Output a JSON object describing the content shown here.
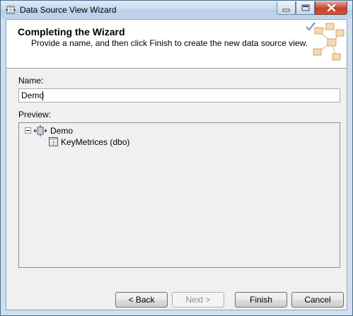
{
  "window": {
    "title": "Data Source View Wizard"
  },
  "header": {
    "title": "Completing the Wizard",
    "subtitle": "Provide a name, and then click Finish to create the new data source view."
  },
  "form": {
    "name_label": "Name:",
    "name_value": "Demo",
    "preview_label": "Preview:"
  },
  "preview_tree": {
    "root": {
      "label": "Demo",
      "expanded": true,
      "icon": "data-source-view-icon"
    },
    "children": [
      {
        "label": "KeyMetrices (dbo)",
        "icon": "table-icon"
      }
    ]
  },
  "buttons": {
    "back": "< Back",
    "next": "Next >",
    "finish": "Finish",
    "cancel": "Cancel"
  },
  "colors": {
    "titlebar": "#c6d9ee",
    "close_button": "#c7402c",
    "dialog_body": "#f0f0f0"
  }
}
